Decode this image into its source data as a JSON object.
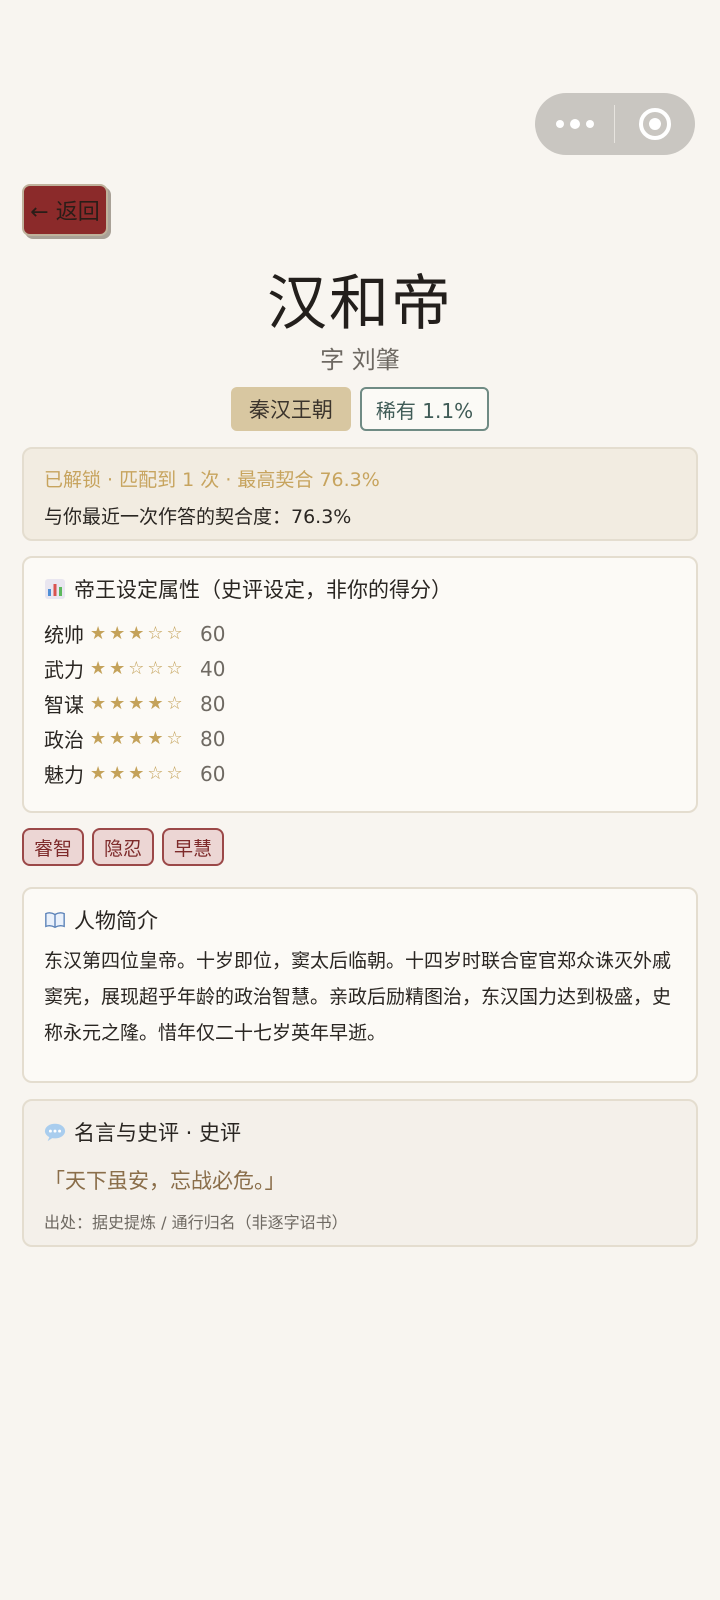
{
  "nav": {
    "back_label": "← 返回"
  },
  "hero": {
    "name": "汉和帝",
    "courtesy": "字 刘肇",
    "dynasty": "秦汉王朝",
    "rarity": "稀有 1.1%"
  },
  "status": {
    "summary": "已解锁 · 匹配到 1 次 · 最高契合 76.3%",
    "latest": "与你最近一次作答的契合度：76.3%"
  },
  "attributes": {
    "heading": "帝王设定属性（史评设定，非你的得分）",
    "items": [
      {
        "name": "统帅",
        "stars": "★★★☆☆",
        "value": "60",
        "rating": 3
      },
      {
        "name": "武力",
        "stars": "★★☆☆☆",
        "value": "40",
        "rating": 2
      },
      {
        "name": "智谋",
        "stars": "★★★★☆",
        "value": "80",
        "rating": 4
      },
      {
        "name": "政治",
        "stars": "★★★★☆",
        "value": "80",
        "rating": 4
      },
      {
        "name": "魅力",
        "stars": "★★★☆☆",
        "value": "60",
        "rating": 3
      }
    ]
  },
  "traits": [
    "睿智",
    "隐忍",
    "早慧"
  ],
  "bio": {
    "heading": "人物简介",
    "text": "东汉第四位皇帝。十岁即位，窦太后临朝。十四岁时联合宦官郑众诛灭外戚窦宪，展现超乎年龄的政治智慧。亲政后励精图治，东汉国力达到极盛，史称永元之隆。惜年仅二十七岁英年早逝。"
  },
  "quote": {
    "heading": "名言与史评 · 史评",
    "text": "「天下虽安，忘战必危。」",
    "source": "出处：据史提炼 / 通行归名（非逐字诏书）"
  },
  "colors": {
    "background": "#f8f5f0",
    "back_button": "#8b2a2a",
    "dynasty_tag": "#d8c7a1",
    "star_gold": "#c4a25a",
    "trait_border": "#9b4848"
  }
}
